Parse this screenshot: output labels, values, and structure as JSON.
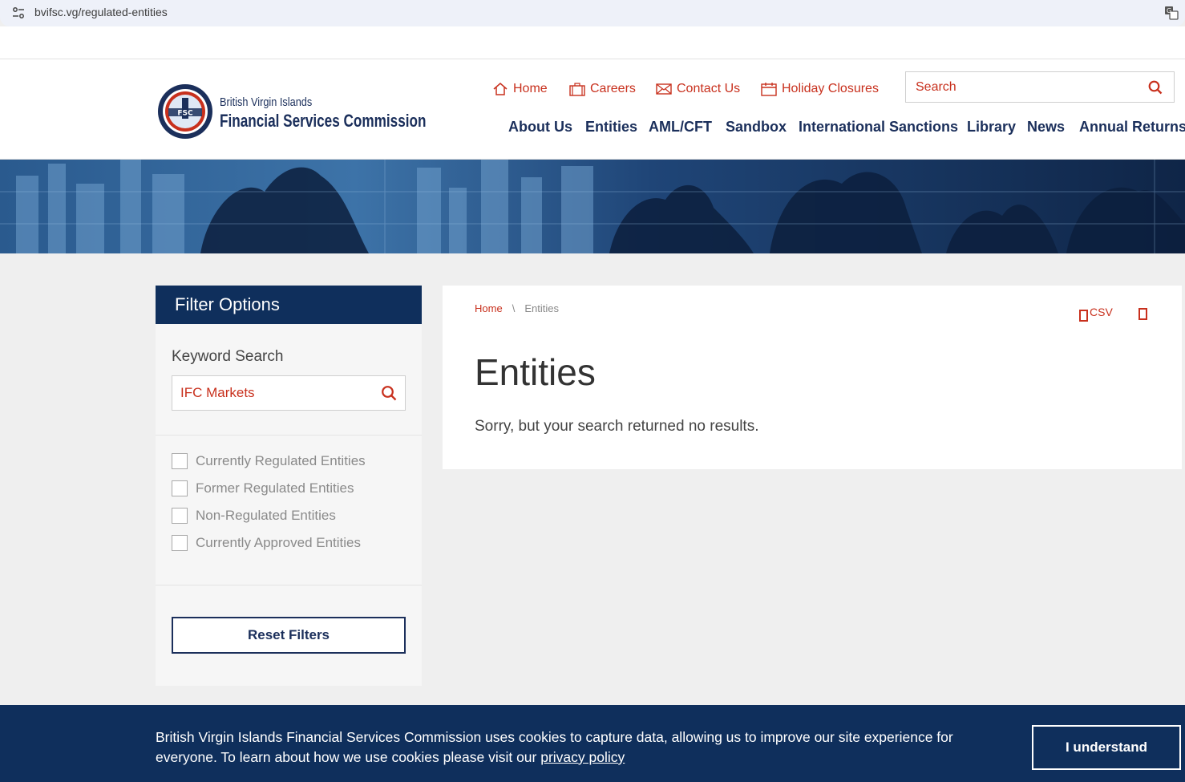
{
  "browser": {
    "url": "bvifsc.vg/regulated-entities"
  },
  "logo": {
    "line1": "British Virgin Islands",
    "line2": "Financial Services Commission",
    "seal_text": "FSC"
  },
  "utility_nav": [
    {
      "label": "Home",
      "icon": "house-icon"
    },
    {
      "label": "Careers",
      "icon": "briefcase-icon"
    },
    {
      "label": "Contact Us",
      "icon": "envelope-icon"
    },
    {
      "label": "Holiday Closures",
      "icon": "calendar-icon"
    }
  ],
  "search": {
    "placeholder": "Search"
  },
  "main_nav": [
    "About Us",
    "Entities",
    "AML/CFT",
    "Sandbox",
    "International Sanctions",
    "Library",
    "News",
    "Annual Returns"
  ],
  "filter": {
    "title": "Filter Options",
    "keyword_label": "Keyword Search",
    "keyword_value": "IFC Markets",
    "options": [
      "Currently Regulated Entities",
      "Former Regulated Entities",
      "Non-Regulated Entities",
      "Currently Approved Entities"
    ],
    "reset_label": "Reset Filters"
  },
  "content": {
    "breadcrumb_home": "Home",
    "breadcrumb_sep": "\\",
    "breadcrumb_current": "Entities",
    "csv_label": "CSV",
    "title": "Entities",
    "message": "Sorry, but your search returned no results."
  },
  "cookie": {
    "text": "British Virgin Islands Financial Services Commission uses cookies to capture data, allowing us to improve our site experience for everyone. To learn about how we use cookies please visit our ",
    "link": "privacy policy",
    "button": "I understand"
  },
  "colors": {
    "navy": "#0f2f5c",
    "accent_red": "#c8301d",
    "page_bg": "#efefef"
  }
}
